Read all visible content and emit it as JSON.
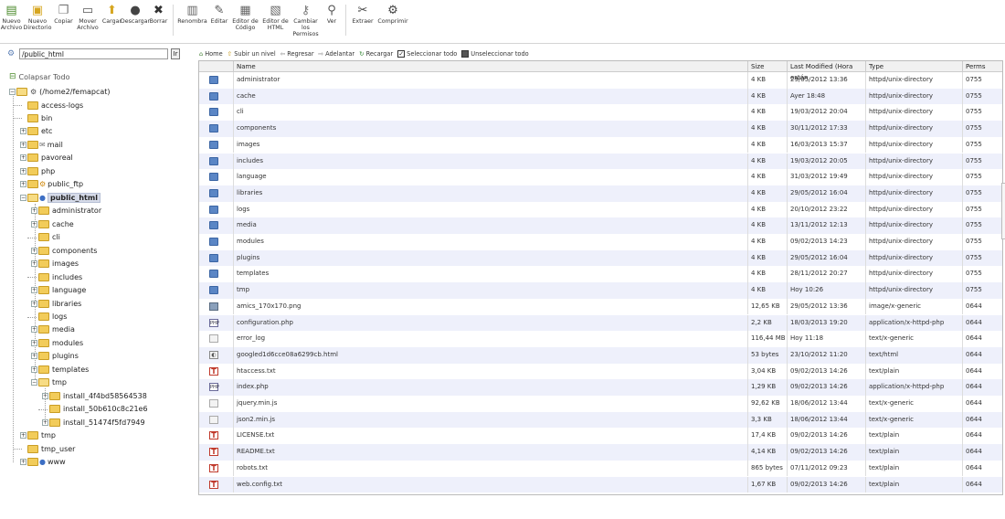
{
  "toolbar": {
    "buttons": [
      {
        "label": "Nuevo\nArchivo",
        "icon": "new-file-icon"
      },
      {
        "label": "Nuevo\nDirectorio",
        "icon": "new-folder-icon"
      },
      {
        "label": "Copiar",
        "icon": "copy-icon"
      },
      {
        "label": "Mover\nArchivo",
        "icon": "move-icon"
      },
      {
        "label": "Cargar",
        "icon": "upload-icon"
      },
      {
        "label": "Descargar",
        "icon": "download-icon"
      },
      {
        "label": "Borrar",
        "icon": "delete-icon"
      },
      {
        "label": "Renombra",
        "icon": "rename-icon"
      },
      {
        "label": "Editar",
        "icon": "edit-icon"
      },
      {
        "label": "Editor de\nCódigo",
        "icon": "code-editor-icon"
      },
      {
        "label": "Editor de\nHTML",
        "icon": "html-editor-icon"
      },
      {
        "label": "Cambiar\nlos\nPermisos",
        "icon": "permissions-icon"
      },
      {
        "label": "Ver",
        "icon": "view-icon"
      },
      {
        "label": "Extraer",
        "icon": "extract-icon"
      },
      {
        "label": "Comprimir",
        "icon": "compress-icon"
      }
    ]
  },
  "path": {
    "value": "/public_html",
    "go_label": "Ir"
  },
  "tree": {
    "collapse_label": "Colapsar Todo",
    "root_label": "(/home2/femapcat)",
    "items": [
      {
        "label": "access-logs"
      },
      {
        "label": "bin"
      },
      {
        "label": "etc"
      },
      {
        "label": "mail"
      },
      {
        "label": "pavoreal"
      },
      {
        "label": "php"
      },
      {
        "label": "public_ftp"
      },
      {
        "label": "public_html"
      },
      {
        "label": "administrator"
      },
      {
        "label": "cache"
      },
      {
        "label": "cli"
      },
      {
        "label": "components"
      },
      {
        "label": "images"
      },
      {
        "label": "includes"
      },
      {
        "label": "language"
      },
      {
        "label": "libraries"
      },
      {
        "label": "logs"
      },
      {
        "label": "media"
      },
      {
        "label": "modules"
      },
      {
        "label": "plugins"
      },
      {
        "label": "templates"
      },
      {
        "label": "tmp"
      },
      {
        "label": "install_4f4bd58564538"
      },
      {
        "label": "install_50b610c8c21e6"
      },
      {
        "label": "install_51474f5fd7949"
      },
      {
        "label": "tmp"
      },
      {
        "label": "tmp_user"
      },
      {
        "label": "www"
      }
    ]
  },
  "nav": {
    "home": "Home",
    "up": "Subir un nivel",
    "back": "Regresar",
    "forward": "Adelantar",
    "reload": "Recargar",
    "select_all": "Seleccionar todo",
    "unselect_all": "Unseleccionar todo"
  },
  "grid": {
    "columns": [
      "Name",
      "Size",
      "Last Modified (Hora están",
      "Type",
      "Perms"
    ],
    "rows": [
      {
        "icon": "folder-icon",
        "name": "administrator",
        "size": "4 KB",
        "modified": "29/05/2012 13:36",
        "type": "httpd/unix-directory",
        "perms": "0755"
      },
      {
        "icon": "folder-icon",
        "name": "cache",
        "size": "4 KB",
        "modified": "Ayer 18:48",
        "type": "httpd/unix-directory",
        "perms": "0755"
      },
      {
        "icon": "folder-icon",
        "name": "cli",
        "size": "4 KB",
        "modified": "19/03/2012 20:04",
        "type": "httpd/unix-directory",
        "perms": "0755"
      },
      {
        "icon": "folder-icon",
        "name": "components",
        "size": "4 KB",
        "modified": "30/11/2012 17:33",
        "type": "httpd/unix-directory",
        "perms": "0755"
      },
      {
        "icon": "folder-icon",
        "name": "images",
        "size": "4 KB",
        "modified": "16/03/2013 15:37",
        "type": "httpd/unix-directory",
        "perms": "0755"
      },
      {
        "icon": "folder-icon",
        "name": "includes",
        "size": "4 KB",
        "modified": "19/03/2012 20:05",
        "type": "httpd/unix-directory",
        "perms": "0755"
      },
      {
        "icon": "folder-icon",
        "name": "language",
        "size": "4 KB",
        "modified": "31/03/2012 19:49",
        "type": "httpd/unix-directory",
        "perms": "0755"
      },
      {
        "icon": "folder-icon",
        "name": "libraries",
        "size": "4 KB",
        "modified": "29/05/2012 16:04",
        "type": "httpd/unix-directory",
        "perms": "0755"
      },
      {
        "icon": "folder-icon",
        "name": "logs",
        "size": "4 KB",
        "modified": "20/10/2012 23:22",
        "type": "httpd/unix-directory",
        "perms": "0755"
      },
      {
        "icon": "folder-icon",
        "name": "media",
        "size": "4 KB",
        "modified": "13/11/2012 12:13",
        "type": "httpd/unix-directory",
        "perms": "0755"
      },
      {
        "icon": "folder-icon",
        "name": "modules",
        "size": "4 KB",
        "modified": "09/02/2013 14:23",
        "type": "httpd/unix-directory",
        "perms": "0755"
      },
      {
        "icon": "folder-icon",
        "name": "plugins",
        "size": "4 KB",
        "modified": "29/05/2012 16:04",
        "type": "httpd/unix-directory",
        "perms": "0755"
      },
      {
        "icon": "folder-icon",
        "name": "templates",
        "size": "4 KB",
        "modified": "28/11/2012 20:27",
        "type": "httpd/unix-directory",
        "perms": "0755"
      },
      {
        "icon": "folder-icon",
        "name": "tmp",
        "size": "4 KB",
        "modified": "Hoy 10:26",
        "type": "httpd/unix-directory",
        "perms": "0755"
      },
      {
        "icon": "image-file-icon",
        "name": "amics_170x170.png",
        "size": "12,65 KB",
        "modified": "29/05/2012 13:36",
        "type": "image/x-generic",
        "perms": "0644"
      },
      {
        "icon": "php-file-icon",
        "name": "configuration.php",
        "size": "2,2 KB",
        "modified": "18/03/2013 19:20",
        "type": "application/x-httpd-php",
        "perms": "0644"
      },
      {
        "icon": "generic-file-icon",
        "name": "error_log",
        "size": "116,44 MB",
        "modified": "Hoy 11:18",
        "type": "text/x-generic",
        "perms": "0644"
      },
      {
        "icon": "html-file-icon",
        "name": "googled1d6cce08a6299cb.html",
        "size": "53 bytes",
        "modified": "23/10/2012 11:20",
        "type": "text/html",
        "perms": "0644"
      },
      {
        "icon": "text-file-icon",
        "name": "htaccess.txt",
        "size": "3,04 KB",
        "modified": "09/02/2013 14:26",
        "type": "text/plain",
        "perms": "0644"
      },
      {
        "icon": "php-file-icon",
        "name": "index.php",
        "size": "1,29 KB",
        "modified": "09/02/2013 14:26",
        "type": "application/x-httpd-php",
        "perms": "0644"
      },
      {
        "icon": "generic-file-icon",
        "name": "jquery.min.js",
        "size": "92,62 KB",
        "modified": "18/06/2012 13:44",
        "type": "text/x-generic",
        "perms": "0644"
      },
      {
        "icon": "generic-file-icon",
        "name": "json2.min.js",
        "size": "3,3 KB",
        "modified": "18/06/2012 13:44",
        "type": "text/x-generic",
        "perms": "0644"
      },
      {
        "icon": "text-file-icon",
        "name": "LICENSE.txt",
        "size": "17,4 KB",
        "modified": "09/02/2013 14:26",
        "type": "text/plain",
        "perms": "0644"
      },
      {
        "icon": "text-file-icon",
        "name": "README.txt",
        "size": "4,14 KB",
        "modified": "09/02/2013 14:26",
        "type": "text/plain",
        "perms": "0644"
      },
      {
        "icon": "text-file-icon",
        "name": "robots.txt",
        "size": "865 bytes",
        "modified": "07/11/2012 09:23",
        "type": "text/plain",
        "perms": "0644"
      },
      {
        "icon": "text-file-icon",
        "name": "web.config.txt",
        "size": "1,67 KB",
        "modified": "09/02/2013 14:26",
        "type": "text/plain",
        "perms": "0644"
      }
    ]
  },
  "colors": {
    "row_alt": "#eef0fb",
    "folder_blue": "#5b86c5",
    "folder_yellow": "#f2cc5a",
    "text_icon_red": "#c0392b"
  }
}
